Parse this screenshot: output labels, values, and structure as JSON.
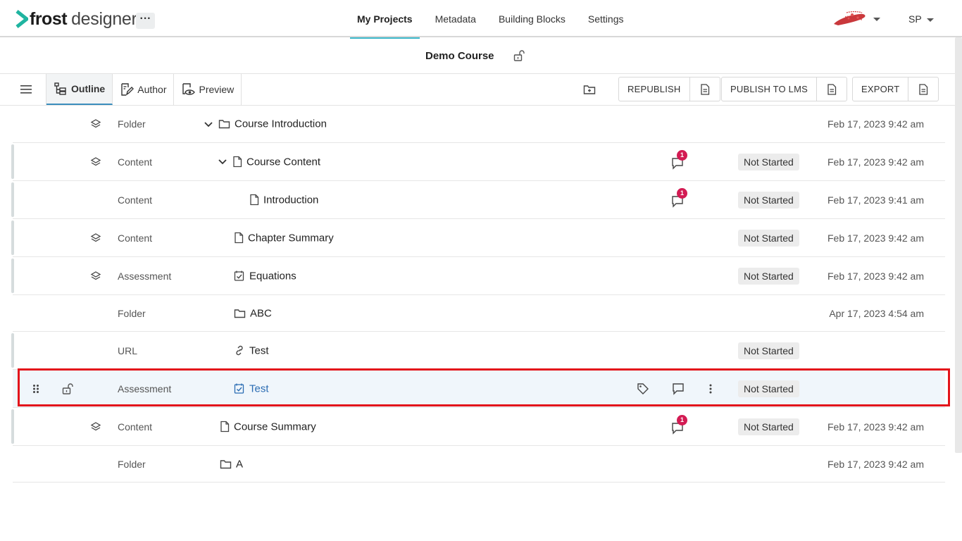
{
  "header": {
    "brand_bold": "frost",
    "brand_light": "designer",
    "more_label": "···",
    "nav": [
      {
        "label": "My Projects",
        "active": true
      },
      {
        "label": "Metadata",
        "active": false
      },
      {
        "label": "Building Blocks",
        "active": false
      },
      {
        "label": "Settings",
        "active": false
      }
    ],
    "user_initials": "SP"
  },
  "course": {
    "title": "Demo Course"
  },
  "toolbar": {
    "tabs": [
      {
        "label": "Outline",
        "icon": "outline-icon",
        "active": true
      },
      {
        "label": "Author",
        "icon": "author-icon",
        "active": false
      },
      {
        "label": "Preview",
        "icon": "preview-icon",
        "active": false
      }
    ],
    "republish_label": "REPUBLISH",
    "publish_lms_label": "PUBLISH TO LMS",
    "export_label": "EXPORT"
  },
  "rows": [
    {
      "type": "Folder",
      "name": "Course Introduction",
      "icon": "folder-icon",
      "chevron": true,
      "layer": true,
      "comments": null,
      "status": "",
      "date": "Feb 17, 2023 9:42 am"
    },
    {
      "type": "Content",
      "name": "Course Content",
      "icon": "page-icon",
      "chevron": true,
      "layer": true,
      "comments": "1",
      "status": "Not Started",
      "date": "Feb 17, 2023 9:42 am"
    },
    {
      "type": "Content",
      "name": "Introduction",
      "icon": "page-icon",
      "chevron": false,
      "layer": false,
      "comments": "1",
      "status": "Not Started",
      "date": "Feb 17, 2023 9:41 am"
    },
    {
      "type": "Content",
      "name": "Chapter Summary",
      "icon": "page-icon",
      "chevron": false,
      "layer": true,
      "comments": null,
      "status": "Not Started",
      "date": "Feb 17, 2023 9:42 am"
    },
    {
      "type": "Assessment",
      "name": "Equations",
      "icon": "checkbox-icon",
      "chevron": false,
      "layer": true,
      "comments": null,
      "status": "Not Started",
      "date": "Feb 17, 2023 9:42 am"
    },
    {
      "type": "Folder",
      "name": "ABC",
      "icon": "folder-icon",
      "chevron": false,
      "layer": false,
      "comments": null,
      "status": "",
      "date": "Apr 17, 2023 4:54 am"
    },
    {
      "type": "URL",
      "name": "Test",
      "icon": "link-icon",
      "chevron": false,
      "layer": false,
      "comments": null,
      "status": "Not Started",
      "date": ""
    },
    {
      "type": "Assessment",
      "name": "Test",
      "icon": "checkbox-icon",
      "chevron": false,
      "layer": false,
      "comments": null,
      "status": "Not Started",
      "date": "",
      "selected": true
    },
    {
      "type": "Content",
      "name": "Course Summary",
      "icon": "page-icon",
      "chevron": false,
      "layer": true,
      "comments": "1",
      "status": "Not Started",
      "date": "Feb 17, 2023 9:42 am"
    },
    {
      "type": "Folder",
      "name": "A",
      "icon": "folder-icon",
      "chevron": false,
      "layer": false,
      "comments": null,
      "status": "",
      "date": "Feb 17, 2023 9:42 am"
    }
  ],
  "colors": {
    "accent": "#3ab6c9",
    "badge": "#d31b53",
    "selection_border": "#e3141b",
    "link": "#2a6cb3"
  }
}
